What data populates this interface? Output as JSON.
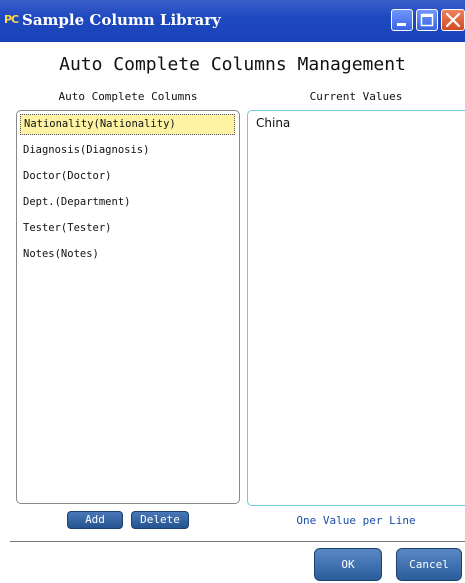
{
  "window": {
    "title": "Sample Column Library",
    "app_icon_text": "PC",
    "accent": "#1f49c0"
  },
  "main": {
    "heading": "Auto Complete Columns Management",
    "columns_label": "Auto Complete Columns",
    "values_label": "Current Values",
    "columns": [
      {
        "label": "Nationality(Nationality)",
        "selected": true
      },
      {
        "label": "Diagnosis(Diagnosis)",
        "selected": false
      },
      {
        "label": "Doctor(Doctor)",
        "selected": false
      },
      {
        "label": "Dept.(Department)",
        "selected": false
      },
      {
        "label": "Tester(Tester)",
        "selected": false
      },
      {
        "label": "Notes(Notes)",
        "selected": false
      }
    ],
    "current_values": "China",
    "add_label": "Add",
    "delete_label": "Delete",
    "hint": "One Value per Line"
  },
  "footer": {
    "ok_label": "OK",
    "cancel_label": "Cancel"
  }
}
